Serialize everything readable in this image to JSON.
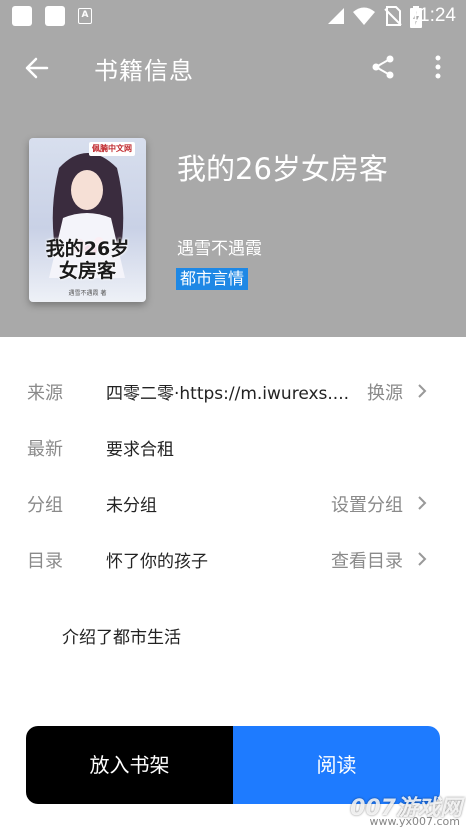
{
  "status_bar": {
    "time": "11:24",
    "icons": [
      "app-icon",
      "app-icon",
      "a-notification-icon",
      "signal-icon",
      "wifi-icon",
      "no-sim-icon",
      "battery-charging-icon"
    ]
  },
  "toolbar": {
    "title": "书籍信息",
    "icons": [
      "back-arrow-icon",
      "share-icon",
      "more-vert-icon"
    ]
  },
  "book": {
    "title": "我的26岁女房客",
    "author": "遇雪不遇霞",
    "category": "都市言情",
    "cover": {
      "site_label": "佩腩中文网",
      "title_line1": "我的26岁",
      "title_line2": "女房客",
      "author_small": "遇雪不遇霞 著"
    }
  },
  "info": {
    "source": {
      "label": "来源",
      "value": "四零二零·https://m.iwurexs....",
      "action": "换源"
    },
    "latest": {
      "label": "最新",
      "value": "要求合租"
    },
    "group": {
      "label": "分组",
      "value": "未分组",
      "action": "设置分组"
    },
    "toc": {
      "label": "目录",
      "value": "怀了你的孩子",
      "action": "查看目录"
    }
  },
  "intro": "介绍了都市生活",
  "buttons": {
    "add_to_shelf": "放入书架",
    "read": "阅读"
  },
  "watermark": {
    "text": "007游戏网",
    "url": "www.yx007.com"
  },
  "colors": {
    "header_bg": "#a9a9a9",
    "accent": "#1e7bff",
    "tag_bg": "#1e88e5"
  }
}
